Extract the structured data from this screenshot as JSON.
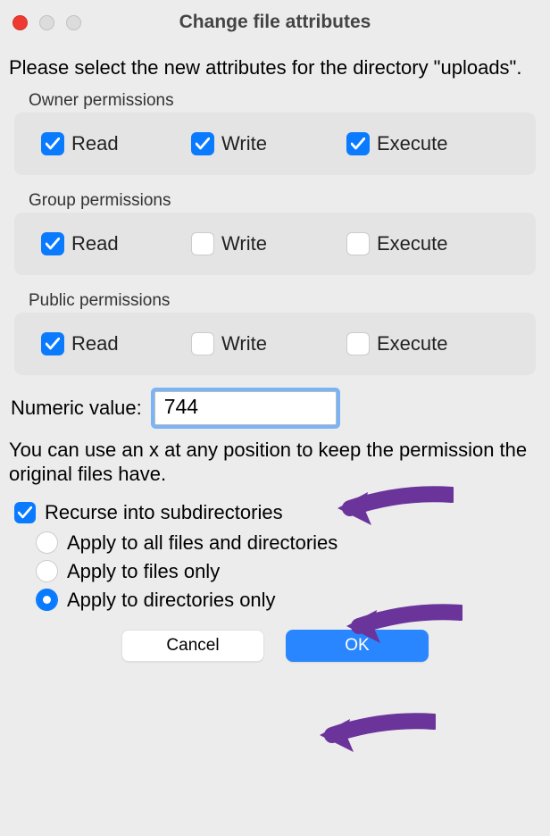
{
  "window": {
    "title": "Change file attributes"
  },
  "intro": "Please select the new attributes for the directory \"uploads\".",
  "groups": {
    "owner": {
      "label": "Owner permissions",
      "read": "Read",
      "write": "Write",
      "execute": "Execute",
      "read_checked": true,
      "write_checked": true,
      "execute_checked": true
    },
    "group": {
      "label": "Group permissions",
      "read": "Read",
      "write": "Write",
      "execute": "Execute",
      "read_checked": true,
      "write_checked": false,
      "execute_checked": false
    },
    "public": {
      "label": "Public permissions",
      "read": "Read",
      "write": "Write",
      "execute": "Execute",
      "read_checked": true,
      "write_checked": false,
      "execute_checked": false
    }
  },
  "numeric": {
    "label": "Numeric value:",
    "value": "744"
  },
  "hint": "You can use an x at any position to keep the permission the original files have.",
  "recurse": {
    "label": "Recurse into subdirectories",
    "checked": true,
    "options": {
      "all": "Apply to all files and directories",
      "files": "Apply to files only",
      "dirs": "Apply to directories only"
    },
    "selected": "dirs"
  },
  "buttons": {
    "cancel": "Cancel",
    "ok": "OK"
  },
  "colors": {
    "accent": "#0a7bff",
    "arrow": "#6b349b"
  }
}
